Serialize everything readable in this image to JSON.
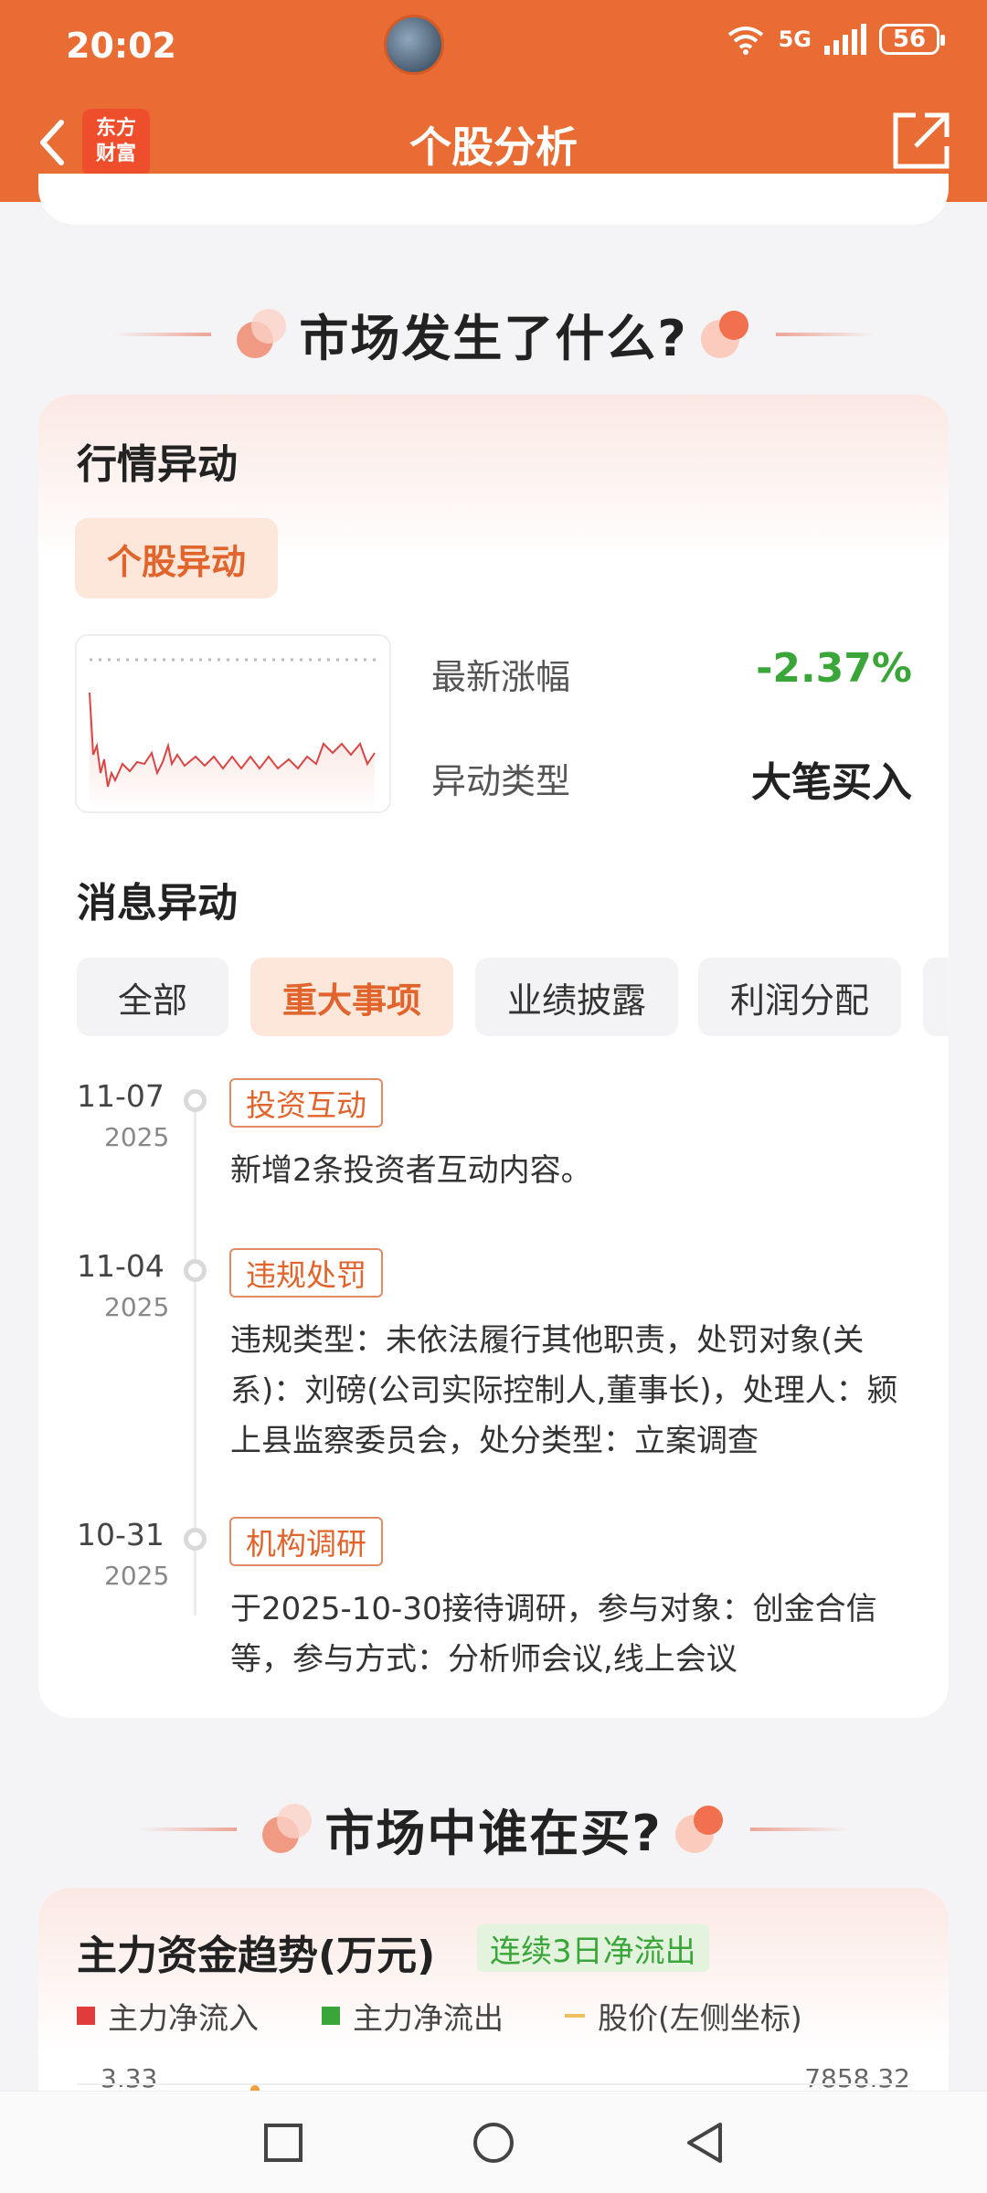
{
  "status_bar": {
    "time": "20:02",
    "network": "5G",
    "battery": "56"
  },
  "header": {
    "title": "个股分析",
    "logo_line1": "东方",
    "logo_line2": "财富"
  },
  "section1": {
    "heading": "市场发生了什么?"
  },
  "market_card": {
    "title": "行情异动",
    "stock_tag": "个股异动",
    "latest_change_label": "最新涨幅",
    "latest_change_value": "-2.37%",
    "anomaly_type_label": "异动类型",
    "anomaly_type_value": "大笔买入",
    "news_title": "消息异动",
    "tabs": [
      "全部",
      "重大事项",
      "业绩披露",
      "利润分配"
    ],
    "active_tab": "重大事项",
    "events": [
      {
        "date": "11-07",
        "year": "2025",
        "tag": "投资互动",
        "text": "新增2条投资者互动内容。"
      },
      {
        "date": "11-04",
        "year": "2025",
        "tag": "违规处罚",
        "text": "违规类型：未依法履行其他职责，处罚对象(关系)：刘磅(公司实际控制人,董事长)，处理人：颍上县监察委员会，处分类型：立案调查"
      },
      {
        "date": "10-31",
        "year": "2025",
        "tag": "机构调研",
        "text": "于2025-10-30接待调研，参与对象：创金合信等，参与方式：分析师会议,线上会议"
      }
    ]
  },
  "section2": {
    "heading": "市场中谁在买?"
  },
  "money_card": {
    "title": "主力资金趋势(万元)",
    "badge": "连续3日净流出",
    "legend": [
      "主力净流入",
      "主力净流出",
      "股价(左侧坐标)"
    ],
    "left_axis_top": "3.33",
    "right_axis_top": "7858.32"
  },
  "colors": {
    "brand": "#e86c33",
    "down_green": "#3aa63a",
    "inflow_red": "#e03c3c",
    "outflow_green": "#3aa63a",
    "price_line": "#f0c060"
  },
  "icons": [
    "back-arrow-icon",
    "share-icon",
    "wifi-icon",
    "signal-icon",
    "battery-icon",
    "square-nav-icon",
    "circle-nav-icon",
    "triangle-back-icon"
  ]
}
